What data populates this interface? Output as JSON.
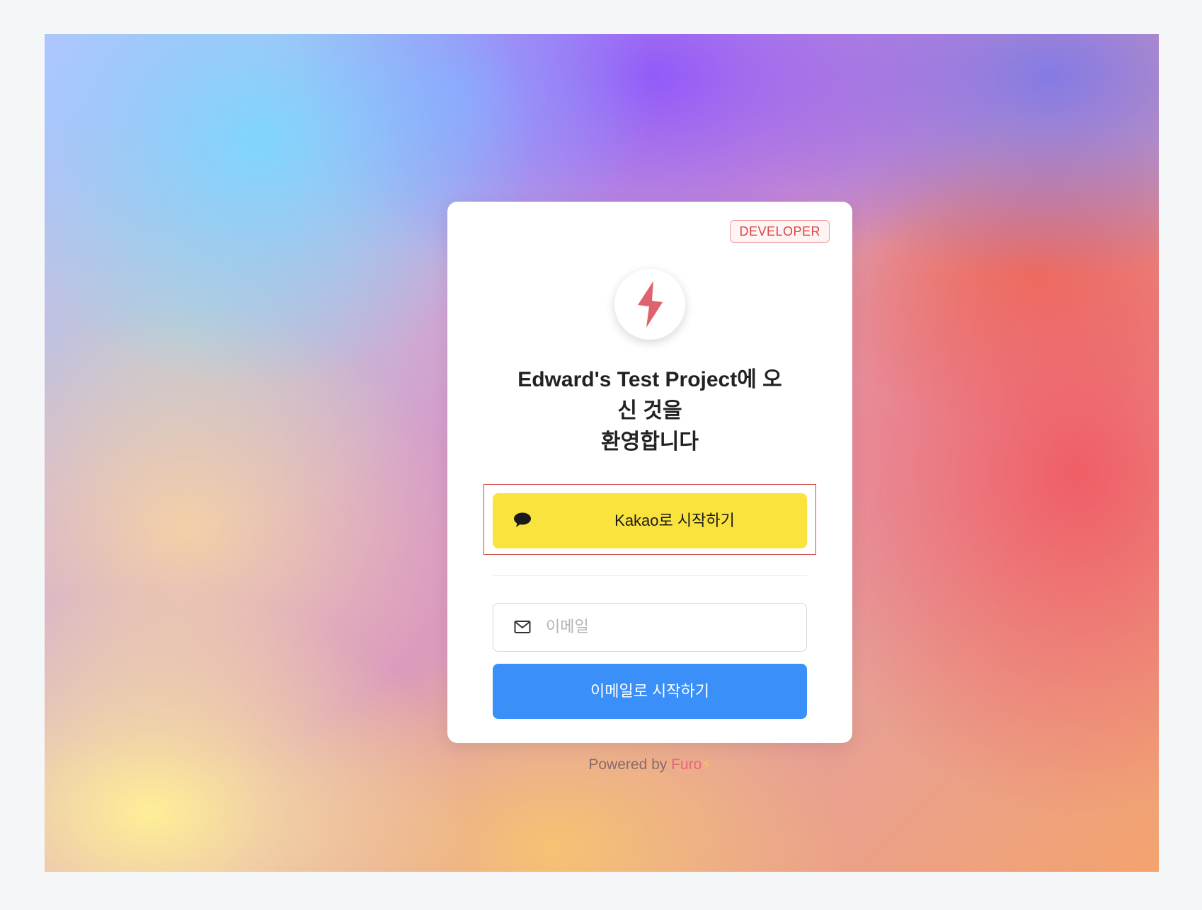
{
  "badge": {
    "label": "DEVELOPER"
  },
  "welcome": {
    "line1": "Edward's Test Project에 오",
    "line2": "신 것을",
    "line3": "환영합니다"
  },
  "kakao": {
    "label": "Kakao로 시작하기",
    "color": "#fae33d"
  },
  "email": {
    "placeholder": "이메일",
    "value": ""
  },
  "email_button": {
    "label": "이메일로 시작하기",
    "color": "#3b8ff8"
  },
  "footer": {
    "prefix": "Powered by",
    "brand": "Furo",
    "brand_icon": "⚡"
  },
  "icons": {
    "logo": "lightning-bolt-icon",
    "kakao": "chat-bubble-icon",
    "email": "mail-icon"
  },
  "colors": {
    "logo_bolt": "#e0626c",
    "badge_text": "#d94545",
    "highlight_outline": "#d23b3b"
  }
}
